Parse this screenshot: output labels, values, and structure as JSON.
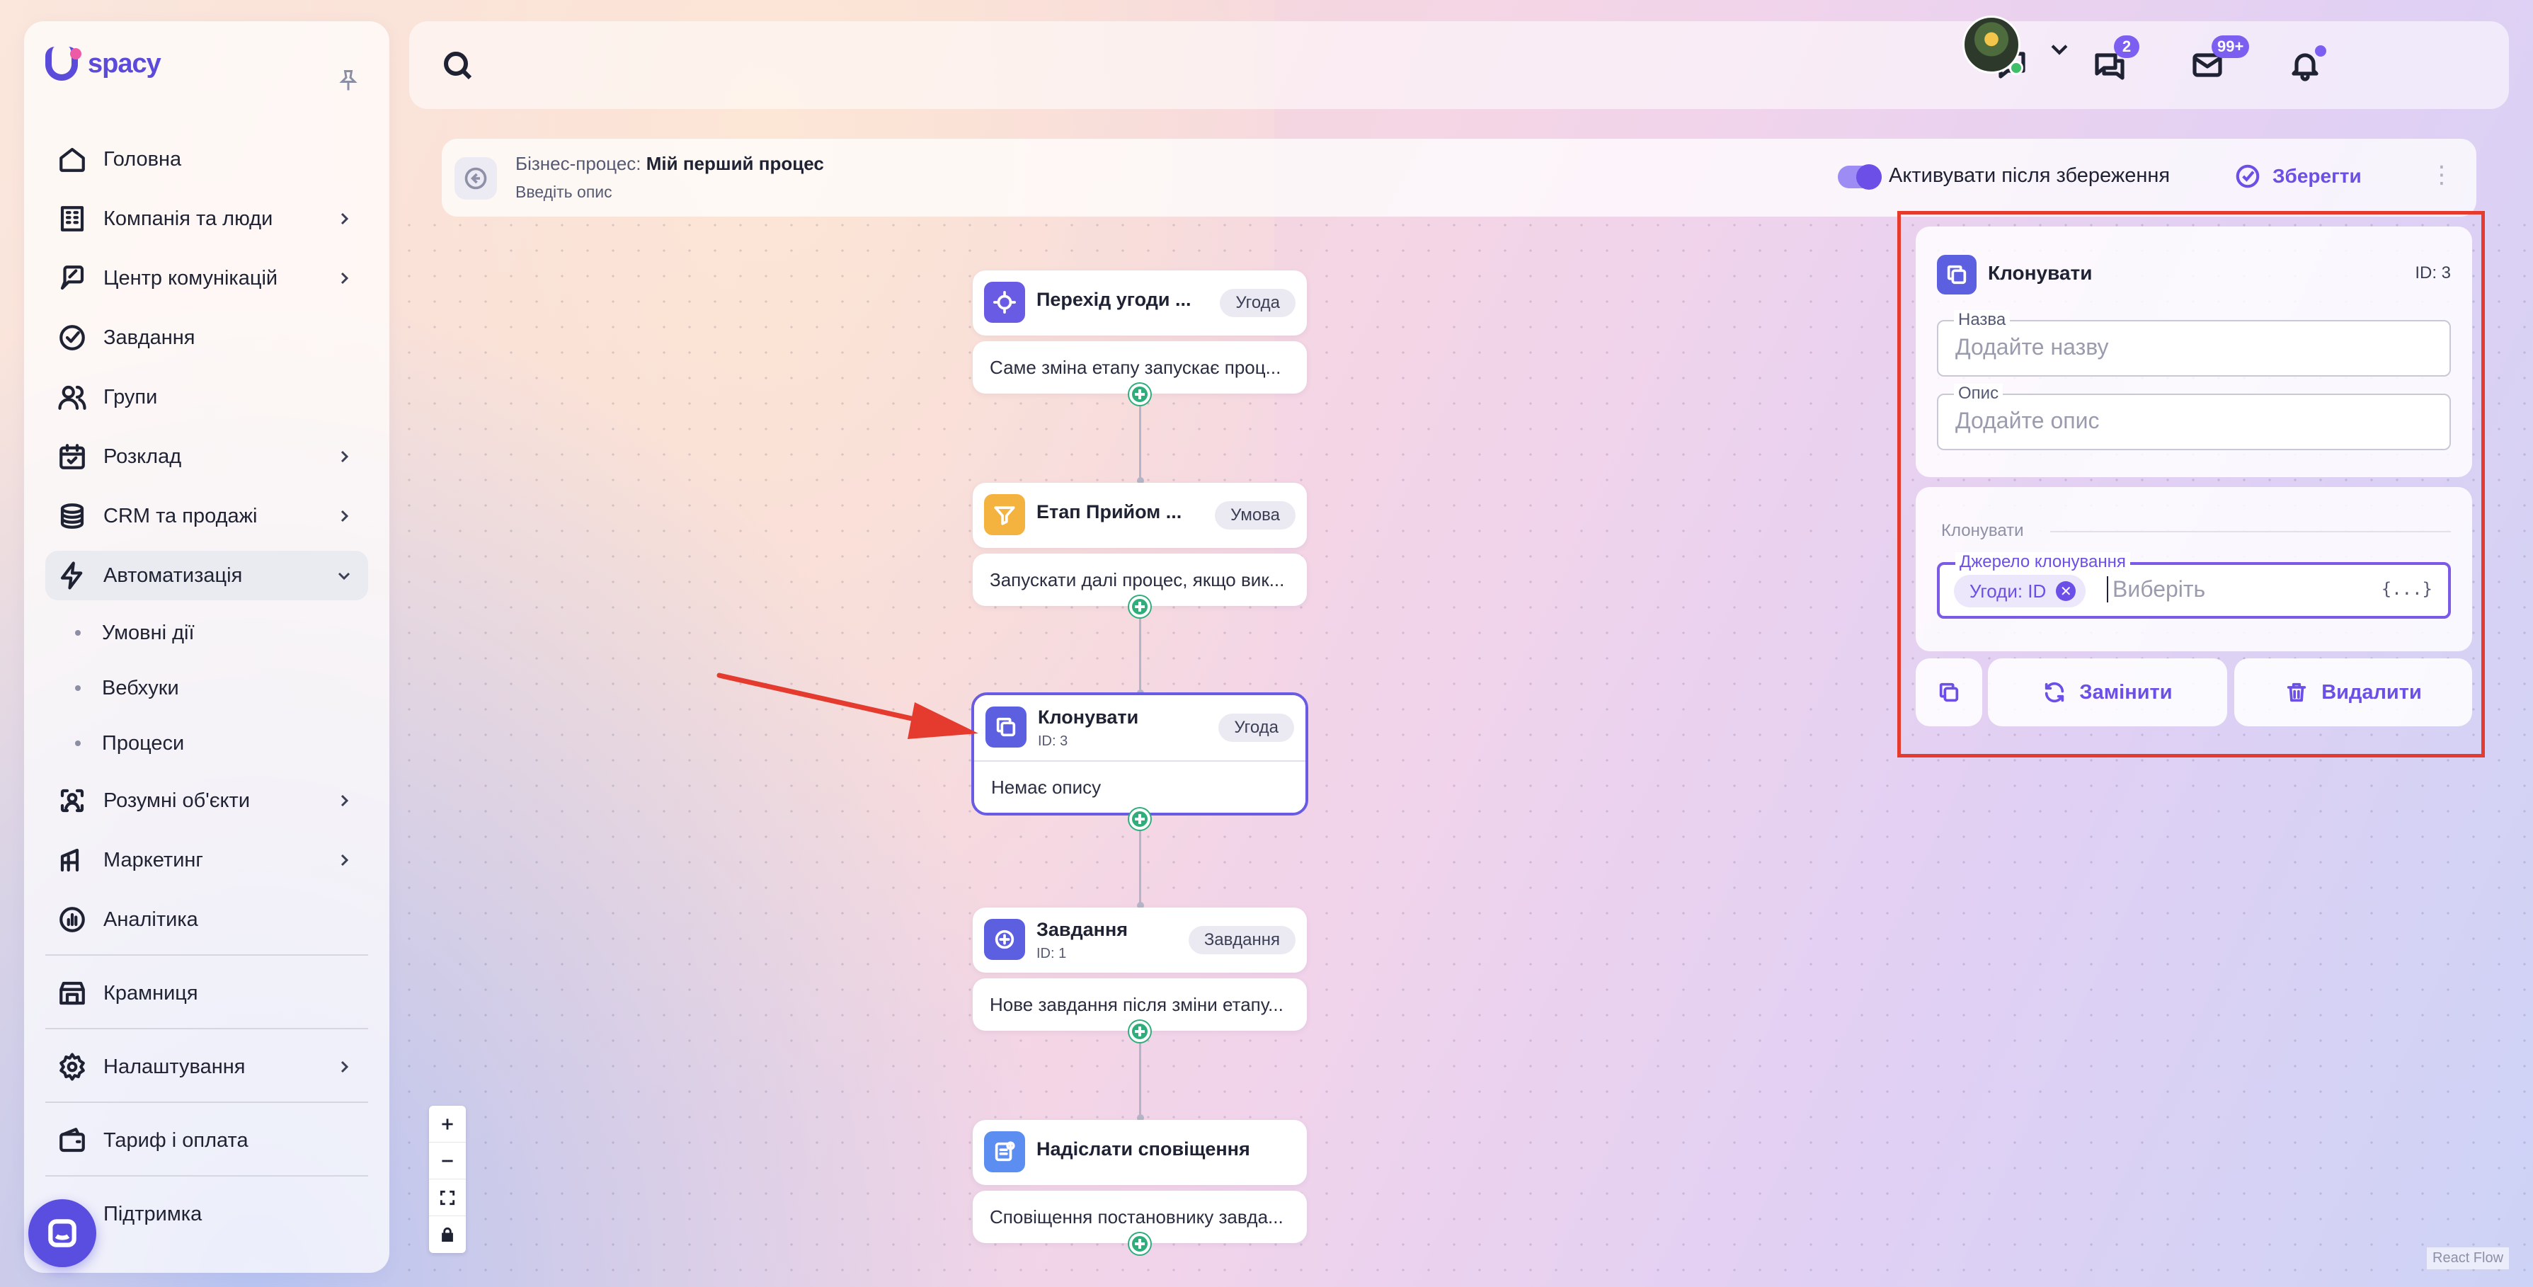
{
  "app": {
    "logo_text": "spacy"
  },
  "sidebar": {
    "items": [
      {
        "label": "Головна",
        "icon": "home-icon"
      },
      {
        "label": "Компанія та люди",
        "icon": "building-icon",
        "has_children": true
      },
      {
        "label": "Центр комунікацій",
        "icon": "chat-edit-icon",
        "has_children": true
      },
      {
        "label": "Завдання",
        "icon": "check-circle-icon"
      },
      {
        "label": "Групи",
        "icon": "users-icon"
      },
      {
        "label": "Розклад",
        "icon": "calendar-icon",
        "has_children": true
      },
      {
        "label": "CRM та продажі",
        "icon": "coins-icon",
        "has_children": true
      },
      {
        "label": "Автоматизація",
        "icon": "lightning-icon",
        "expanded": true
      }
    ],
    "sub_items": [
      "Умовні дії",
      "Вебхуки",
      "Процеси"
    ],
    "items_after": [
      {
        "label": "Розумні об'єкти",
        "icon": "scan-icon",
        "has_children": true
      },
      {
        "label": "Маркетинг",
        "icon": "megaphone-icon",
        "has_children": true
      },
      {
        "label": "Аналітика",
        "icon": "chart-icon"
      }
    ],
    "store": "Крамниця",
    "settings": "Налаштування",
    "billing": "Тариф і оплата",
    "support": "Підтримка"
  },
  "topbar": {
    "chat_badge": "2",
    "mail_badge": "99+"
  },
  "process": {
    "prefix": "Бізнес-процес:",
    "name": "Мій перший процес",
    "description": "Введіть опис",
    "toggle_label": "Активувати після збереження",
    "save_label": "Зберегти"
  },
  "nodes": [
    {
      "title": "Перехід угоди ...",
      "tag": "Угода",
      "body": "Саме зміна етапу запускає проц...",
      "color": "#6a5be4"
    },
    {
      "title": "Етап Прийом ...",
      "tag": "Умова",
      "body": "Запускати далі процес, якщо вик...",
      "color": "#f4b23e"
    },
    {
      "title": "Клонувати",
      "id": "ID: 3",
      "tag": "Угода",
      "body": "Немає опису",
      "color": "#5b5fe0"
    },
    {
      "title": "Завдання",
      "id": "ID: 1",
      "tag": "Завдання",
      "body": "Нове завдання після зміни етапу...",
      "color": "#5b5fe0"
    },
    {
      "title": "Надіслати сповіщення",
      "body": "Сповіщення постановнику завда...",
      "color": "#5b8ef0"
    }
  ],
  "panel": {
    "title": "Клонувати",
    "id": "ID: 3",
    "name_label": "Назва",
    "name_placeholder": "Додайте назву",
    "desc_label": "Опис",
    "desc_placeholder": "Додайте опис",
    "section_label": "Клонувати",
    "source_label": "Джерело клонування",
    "source_chip": "Угоди: ID",
    "source_placeholder": "Виберіть",
    "var_icon": "{...}",
    "replace_label": "Замінити",
    "delete_label": "Видалити"
  },
  "flow": {
    "attribution": "React Flow"
  },
  "colors": {
    "accent": "#6b4fe6",
    "highlight": "#e53a2e",
    "port": "#2fae7c"
  }
}
